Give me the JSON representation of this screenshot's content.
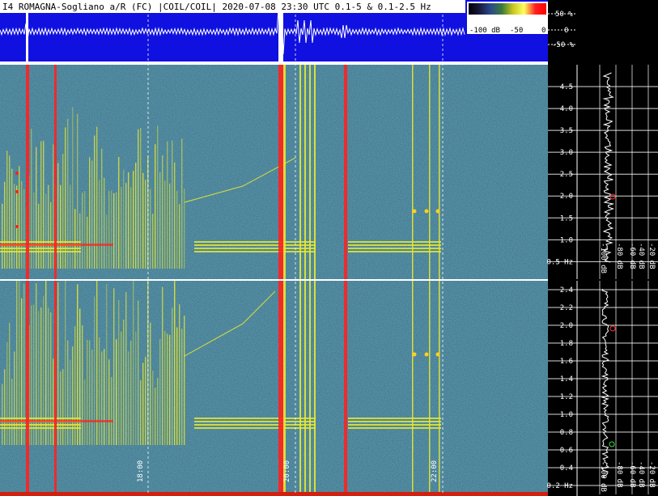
{
  "header": {
    "title": "I4 ROMAGNA-Sogliano a/R (FC) |COIL/COIL| 2020-07-08 23:30 UTC 0.1-5 & 0.1-2.5  Hz"
  },
  "colorbar": {
    "labels": [
      "-100 dB",
      "-50",
      "0"
    ],
    "colors": [
      "#000000",
      "#1a1a40",
      "#2a4a8a",
      "#3a7a3a",
      "#c8c820",
      "#ffff60",
      "#ff2020",
      "#ff0000"
    ]
  },
  "waveform": {
    "pct_labels": [
      "50 %",
      "0",
      "-50 %"
    ],
    "background": "#1010e0"
  },
  "time_axis": {
    "labels": [
      "18:00",
      "20:00",
      "22:00"
    ]
  },
  "upper_panel": {
    "freq_labels": [
      "4.5",
      "4.0",
      "3.5",
      "3.0",
      "2.5",
      "2.0",
      "1.5",
      "1.0",
      "0.5 Hz"
    ],
    "freq_values": [
      4.5,
      4.0,
      3.5,
      3.0,
      2.5,
      2.0,
      1.5,
      1.0,
      0.5
    ],
    "range": [
      0.1,
      5.0
    ],
    "db_labels": [
      "-100 dB",
      "-80 dB",
      "-60 dB",
      "-40 dB",
      "-20 dB"
    ]
  },
  "lower_panel": {
    "freq_labels": [
      "2.4",
      "2.2",
      "2.0",
      "1.8",
      "1.6",
      "1.4",
      "1.2",
      "1.0",
      "0.8",
      "0.6",
      "0.4",
      "0.2 Hz"
    ],
    "freq_values": [
      2.4,
      2.2,
      2.0,
      1.8,
      1.6,
      1.4,
      1.2,
      1.0,
      0.8,
      0.6,
      0.4,
      0.2
    ],
    "range": [
      0.1,
      2.5
    ],
    "db_labels": [
      "-100 dB",
      "-80 dB",
      "-60 dB",
      "-40 dB",
      "-20 dB"
    ]
  },
  "colors": {
    "background": "#000000",
    "spectrogram_base": "#1c2a3a",
    "signal_yellow": "#e8e830",
    "signal_red": "#ff2020",
    "grid_white": "#ffffff",
    "spectrum_trace": "#ffffff"
  }
}
